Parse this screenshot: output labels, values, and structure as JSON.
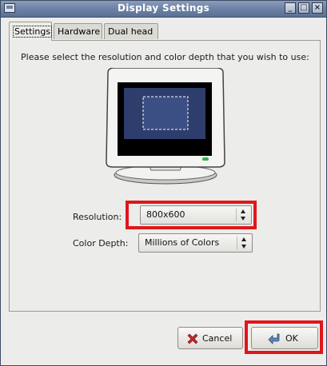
{
  "window": {
    "title": "Display Settings"
  },
  "tabs": [
    {
      "label": "Settings",
      "active": true
    },
    {
      "label": "Hardware",
      "active": false
    },
    {
      "label": "Dual head",
      "active": false
    }
  ],
  "settings": {
    "instructions": "Please select the resolution and color depth that you wish to use:",
    "resolution_label": "Resolution:",
    "resolution_value": "800x600",
    "color_depth_label": "Color Depth:",
    "color_depth_value": "Millions of Colors"
  },
  "buttons": {
    "cancel_label": "Cancel",
    "ok_label": "OK"
  },
  "icons": [
    "window-menu-icon",
    "minimize-icon",
    "maximize-icon",
    "close-icon",
    "monitor-illustration",
    "cancel-x-icon",
    "ok-enter-icon"
  ],
  "colors": {
    "titlebar": "#6f84a8",
    "highlight": "#e0161b",
    "cancel_icon": "#c0262d",
    "monitor_led": "#2fb44a"
  }
}
